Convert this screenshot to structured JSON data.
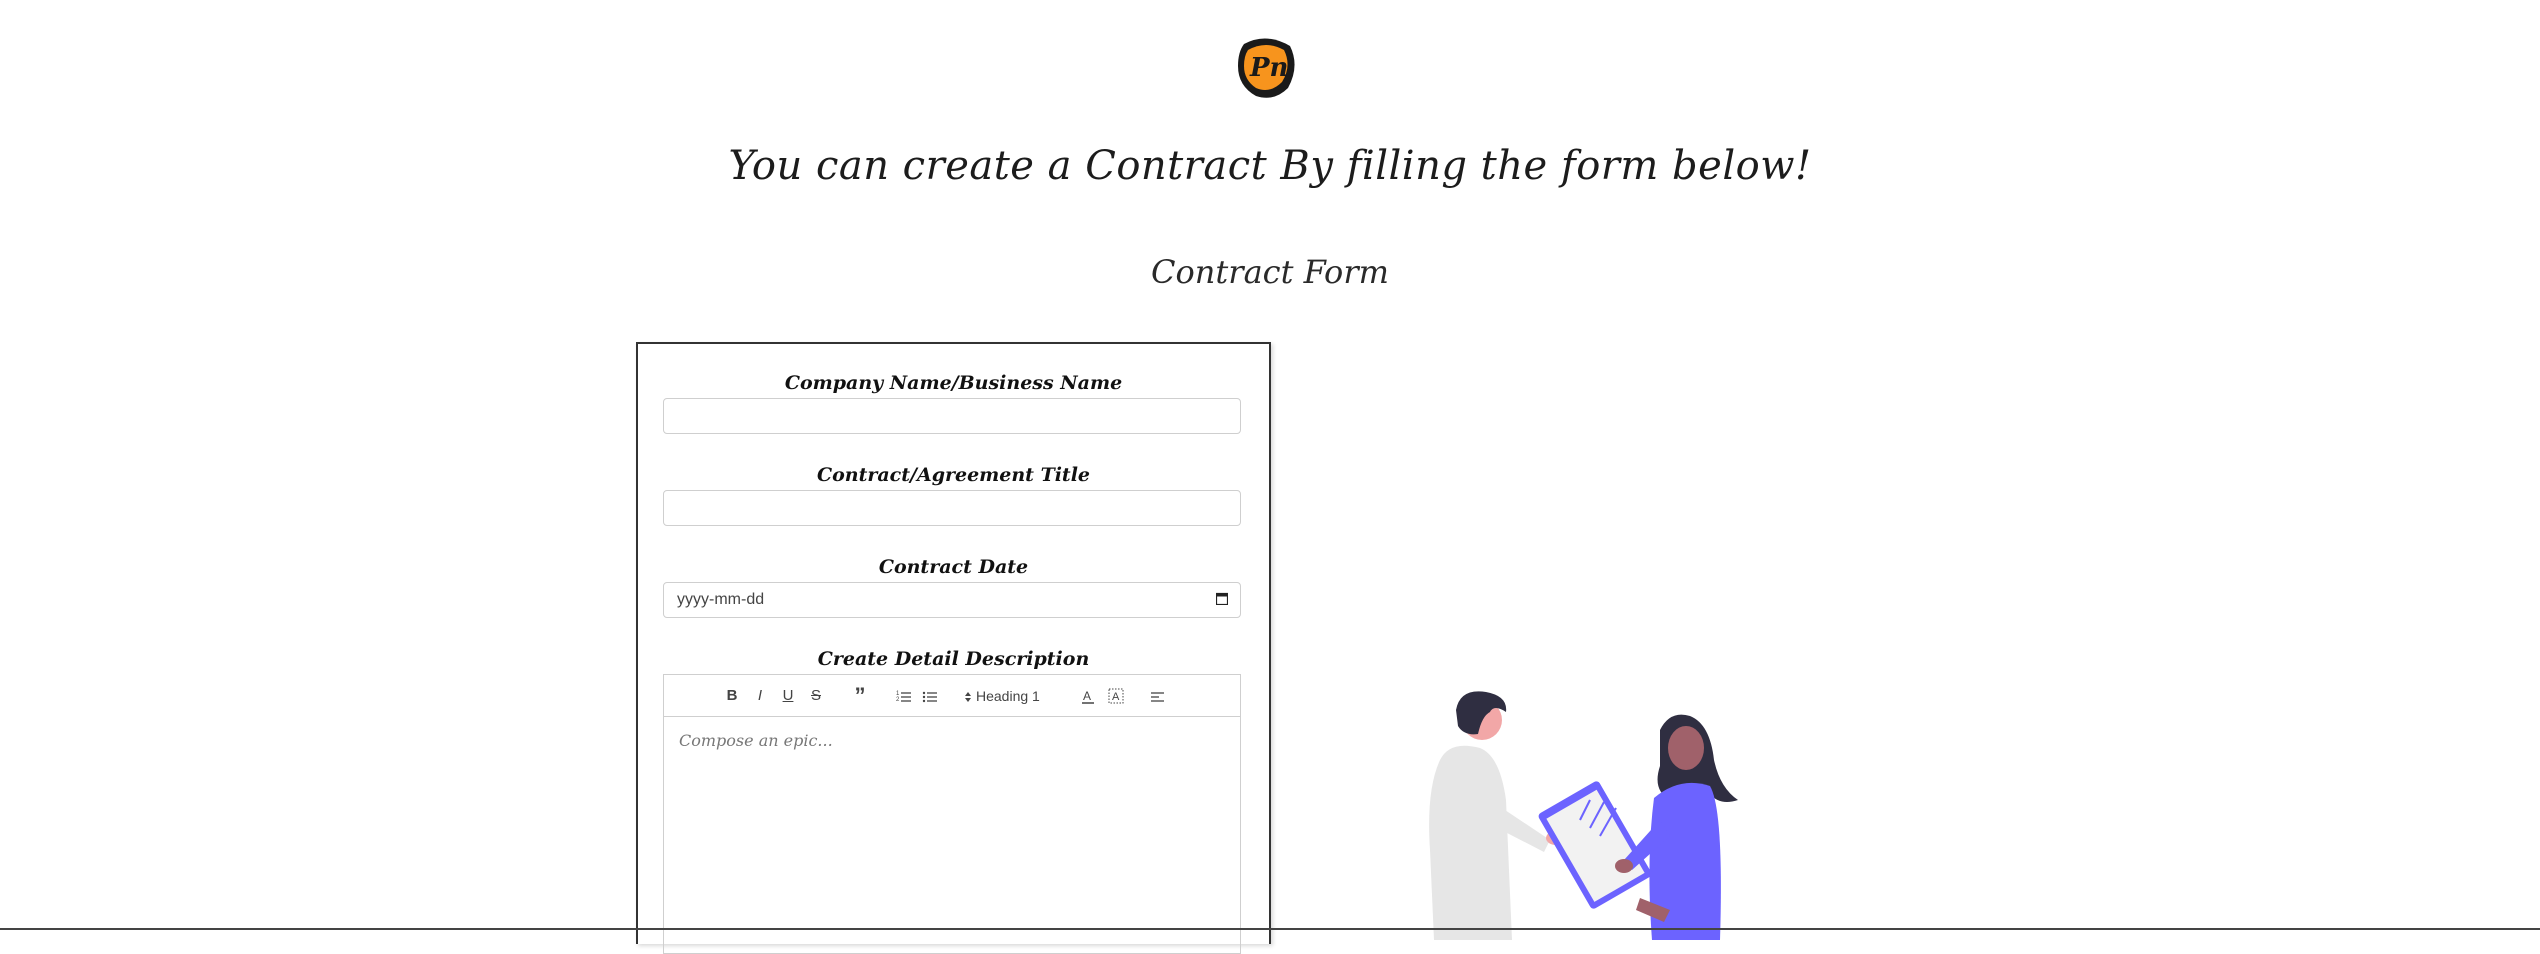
{
  "header": {
    "logo_text": "Pn",
    "title": "You can create a Contract By filling the form below!",
    "subtitle": "Contract Form"
  },
  "form": {
    "company_label": "Company Name/Business Name",
    "company_value": "",
    "title_label": "Contract/Agreement Title",
    "title_value": "",
    "date_label": "Contract Date",
    "date_placeholder": "yyyy-mm-dd",
    "description_label": "Create Detail Description",
    "editor": {
      "bold": "B",
      "italic": "I",
      "underline": "U",
      "strike": "S",
      "quote": "”",
      "heading_select": "Heading 1",
      "placeholder": "Compose an epic..."
    }
  },
  "colors": {
    "logo_orange": "#f7941d",
    "logo_dark": "#1a1a1a",
    "illustration_purple": "#6c63ff",
    "illustration_dark": "#2f2e41"
  }
}
